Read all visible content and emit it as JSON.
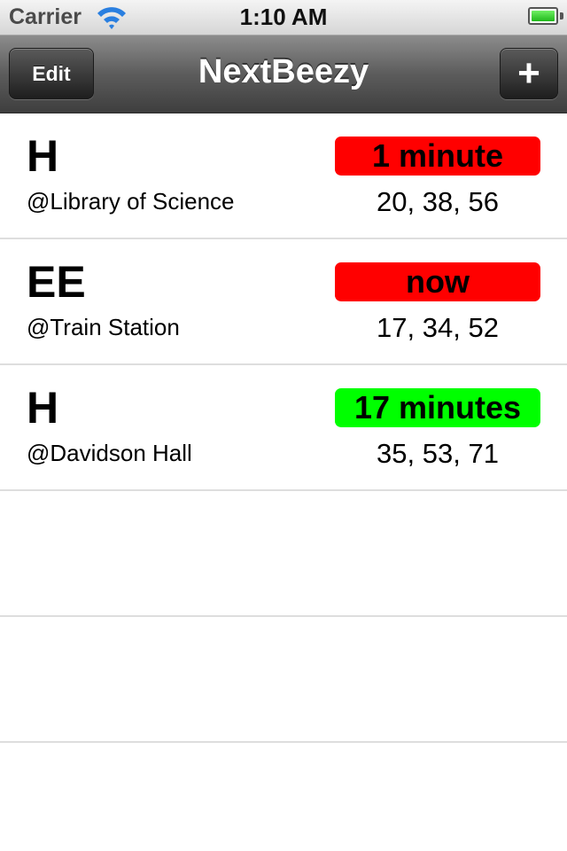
{
  "status_bar": {
    "carrier": "Carrier",
    "time": "1:10 AM",
    "wifi_icon": "wifi-icon",
    "battery_icon": "battery-icon",
    "battery_level": 1.0
  },
  "nav": {
    "title": "NextBeezy",
    "edit_label": "Edit",
    "add_label": "+"
  },
  "colors": {
    "eta_late": "#ff0000",
    "eta_ok": "#00ff00"
  },
  "rows": [
    {
      "route": "H",
      "stop": "@Library of Science",
      "eta": "1 minute",
      "eta_color": "#ff0000",
      "times": "20, 38, 56"
    },
    {
      "route": "EE",
      "stop": "@Train Station",
      "eta": "now",
      "eta_color": "#ff0000",
      "times": "17, 34, 52"
    },
    {
      "route": "H",
      "stop": "@Davidson Hall",
      "eta": "17 minutes",
      "eta_color": "#00ff00",
      "times": "35, 53, 71"
    }
  ]
}
